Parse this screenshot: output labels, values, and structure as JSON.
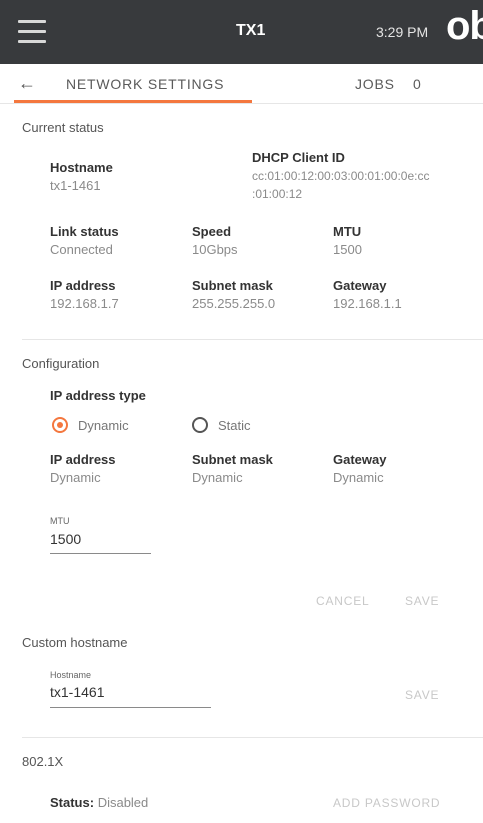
{
  "header": {
    "device_name": "TX1",
    "time": "3:29 PM",
    "logo_text": "ob"
  },
  "tabs": {
    "network_label": "NETWORK SETTINGS",
    "jobs_label": "JOBS",
    "jobs_count": "0"
  },
  "current_status": {
    "title": "Current status",
    "hostname_label": "Hostname",
    "hostname_value": "tx1-1461",
    "dhcp_label": "DHCP Client ID",
    "dhcp_value_line1": "cc:01:00:12:00:03:00:01:00:0e:cc",
    "dhcp_value_line2": ":01:00:12",
    "link_label": "Link status",
    "link_value": "Connected",
    "speed_label": "Speed",
    "speed_value": "10Gbps",
    "mtu_label": "MTU",
    "mtu_value": "1500",
    "ip_label": "IP address",
    "ip_value": "192.168.1.7",
    "subnet_label": "Subnet mask",
    "subnet_value": "255.255.255.0",
    "gateway_label": "Gateway",
    "gateway_value": "192.168.1.1"
  },
  "configuration": {
    "title": "Configuration",
    "ip_type_label": "IP address type",
    "option_dynamic": "Dynamic",
    "option_static": "Static",
    "selected": "Dynamic",
    "ip_label": "IP address",
    "ip_value": "Dynamic",
    "subnet_label": "Subnet mask",
    "subnet_value": "Dynamic",
    "gateway_label": "Gateway",
    "gateway_value": "Dynamic",
    "mtu_field_label": "MTU",
    "mtu_field_value": "1500",
    "cancel_label": "CANCEL",
    "save_label": "SAVE"
  },
  "custom_hostname": {
    "title": "Custom hostname",
    "field_label": "Hostname",
    "field_value": "tx1-1461",
    "save_label": "SAVE"
  },
  "dot1x": {
    "title": "802.1X",
    "status_label": "Status:",
    "status_value": "Disabled",
    "add_password_label": "ADD PASSWORD"
  },
  "colors": {
    "accent": "#f4773e",
    "topbar": "#383a3d"
  }
}
